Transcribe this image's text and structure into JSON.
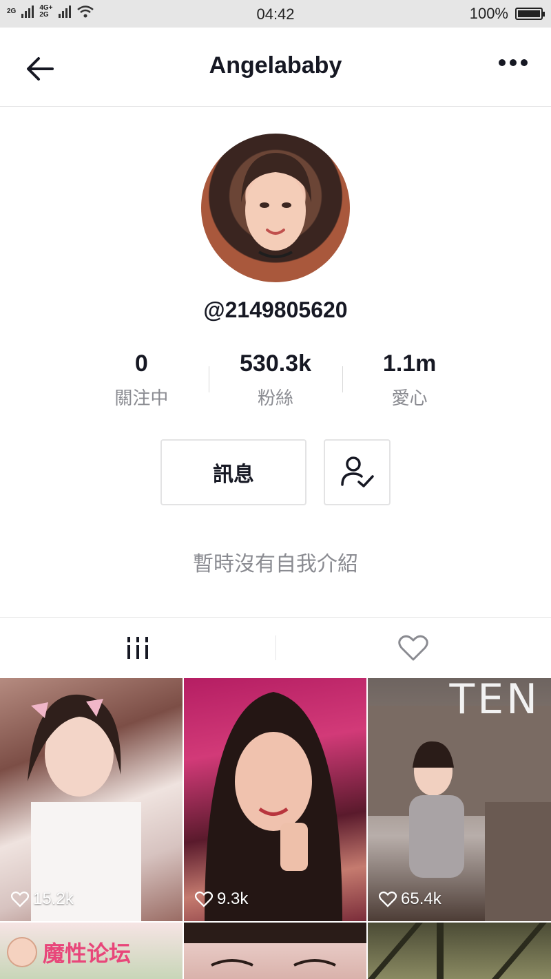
{
  "status_bar": {
    "network_top": "2G",
    "network_mid": "4G+",
    "network_bottom": "2G",
    "time": "04:42",
    "battery_text": "100%",
    "battery_level": 1.0
  },
  "nav": {
    "title": "Angelababy",
    "back_icon": "arrow-left-icon",
    "more_icon": "more-dots-icon"
  },
  "profile": {
    "handle": "@2149805620",
    "stats": [
      {
        "value": "0",
        "label": "關注中"
      },
      {
        "value": "530.3k",
        "label": "粉絲"
      },
      {
        "value": "1.1m",
        "label": "愛心"
      }
    ],
    "message_button": "訊息",
    "followed_icon": "user-check-icon",
    "bio": "暫時沒有自我介紹"
  },
  "tabs": [
    {
      "name": "videos",
      "icon": "grid-bars-icon"
    },
    {
      "name": "liked",
      "icon": "heart-outline-icon"
    }
  ],
  "videos": [
    {
      "likes": "15.2k"
    },
    {
      "likes": "9.3k"
    },
    {
      "likes": "65.4k",
      "overlay_text": "TEN"
    },
    {
      "likes": ""
    },
    {
      "likes": ""
    },
    {
      "likes": ""
    }
  ],
  "watermark": {
    "text": "魔性论坛"
  },
  "colors": {
    "text_primary": "#161823",
    "text_secondary": "#8a8b91",
    "divider": "#e3e3e4"
  }
}
